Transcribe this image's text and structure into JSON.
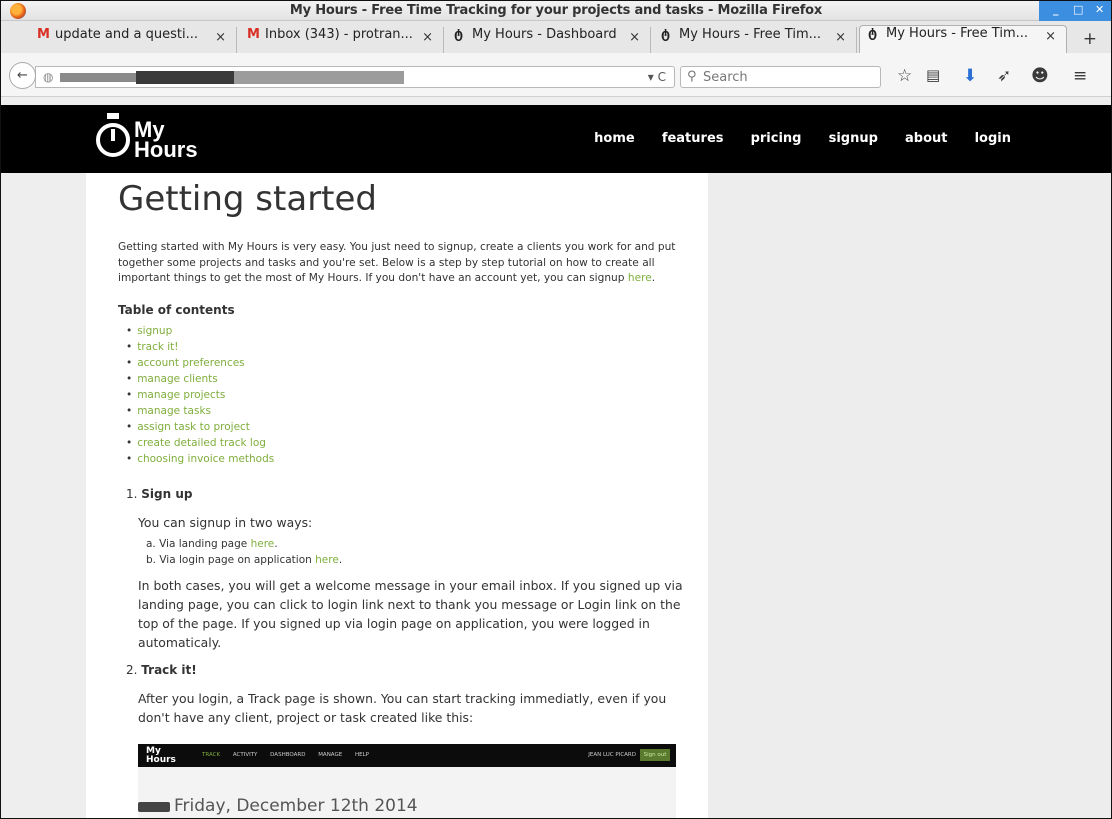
{
  "window": {
    "title": "My Hours - Free Time Tracking for your projects and tasks - Mozilla Firefox"
  },
  "tabs": [
    {
      "label": "update and a questi...",
      "icon": "gmail-icon"
    },
    {
      "label": "Inbox (343) - protran...",
      "icon": "gmail-icon"
    },
    {
      "label": "My Hours - Dashboard",
      "icon": "stopwatch-icon"
    },
    {
      "label": "My Hours - Free Tim...",
      "icon": "stopwatch-icon"
    },
    {
      "label": "My Hours - Free Tim...",
      "icon": "stopwatch-icon",
      "active": true
    }
  ],
  "navbar": {
    "search_placeholder": "Search"
  },
  "site": {
    "logo_line1": "My",
    "logo_line2": "Hours",
    "nav": [
      "home",
      "features",
      "pricing",
      "signup",
      "about",
      "login"
    ]
  },
  "article": {
    "title": "Getting started",
    "intro": "Getting started with My Hours is very easy. You just need to signup, create a clients you work for and put together some projects and tasks and you're set. Below is a step by step tutorial on how to create all important things to get the most of My Hours. If you don't have an account yet, you can signup",
    "intro_link": "here",
    "toc_heading": "Table of contents",
    "toc": [
      "signup",
      "track it!",
      "account preferences",
      "manage clients",
      "manage projects",
      "manage tasks",
      "assign task to project",
      "create detailed track log",
      "choosing invoice methods"
    ],
    "sections": [
      {
        "num": "1.",
        "title": "Sign up",
        "lead": "You can signup in two ways:",
        "items": [
          {
            "prefix": "a. Via landing page",
            "link": "here"
          },
          {
            "prefix": "b. Via login page on application",
            "link": "here"
          }
        ],
        "body": "In both cases, you will get a welcome message in your email inbox. If you signed up via landing page, you can click to login link next to thank you message or Login link on the top of the page. If you signed up via login page on application, you were logged in automaticaly."
      },
      {
        "num": "2.",
        "title": "Track it!",
        "body": "After you login, a Track page is shown. You can start tracking immediatly, even if you don't have any client, project or task created like this:"
      }
    ],
    "screenshot": {
      "logo1": "My",
      "logo2": "Hours",
      "nav": [
        "TRACK",
        "ACTIVITY",
        "DASHBOARD",
        "MANAGE",
        "HELP"
      ],
      "user": "JEAN LUC PICARD",
      "signout": "Sign out",
      "date": "Friday, December 12th 2014"
    }
  }
}
